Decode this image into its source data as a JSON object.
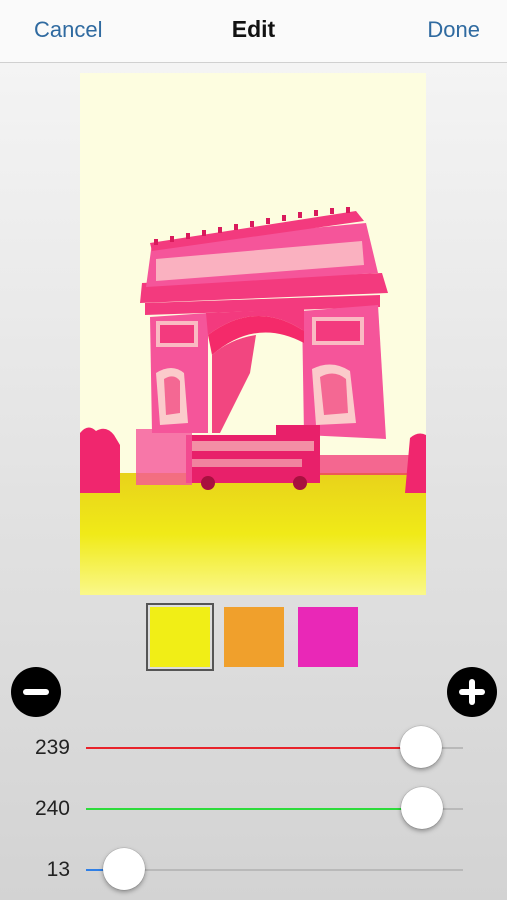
{
  "navbar": {
    "cancel_label": "Cancel",
    "title": "Edit",
    "done_label": "Done"
  },
  "colors": {
    "nav_link": "#2f6aa0"
  },
  "swatches": [
    {
      "name": "yellow",
      "color": "#f1ee16",
      "selected": true
    },
    {
      "name": "orange",
      "color": "#f0a02c",
      "selected": false
    },
    {
      "name": "magenta",
      "color": "#e928b7",
      "selected": false
    }
  ],
  "controls": {
    "remove_icon": "minus-circle-icon",
    "add_icon": "plus-circle-icon"
  },
  "sliders": [
    {
      "name": "red",
      "value": "239",
      "max": 255,
      "color": "#e8232b"
    },
    {
      "name": "green",
      "value": "240",
      "max": 255,
      "color": "#2ddb3b"
    },
    {
      "name": "blue",
      "value": "13",
      "max": 255,
      "color": "#2f7fe6"
    }
  ]
}
